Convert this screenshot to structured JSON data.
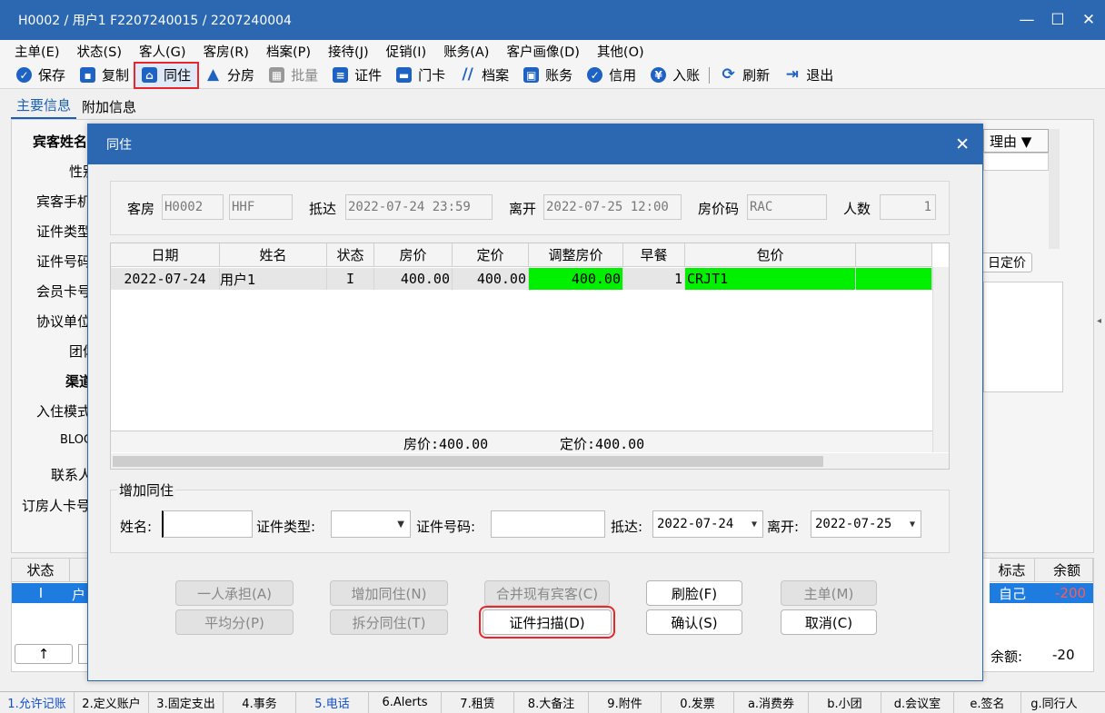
{
  "window": {
    "title": "H0002 / 用户1 F2207240015 / 2207240004",
    "min": "—",
    "max": "☐",
    "close": "✕"
  },
  "menu": [
    "主单(E)",
    "状态(S)",
    "客人(G)",
    "客房(R)",
    "档案(P)",
    "接待(J)",
    "促销(I)",
    "账务(A)",
    "客户画像(D)",
    "其他(O)"
  ],
  "toolbar": {
    "save": "保存",
    "copy": "复制",
    "share": "同住",
    "assign": "分房",
    "batch": "批量",
    "id": "证件",
    "card": "门卡",
    "profile": "档案",
    "account": "账务",
    "credit": "信用",
    "post": "入账",
    "refresh": "刷新",
    "exit": "退出"
  },
  "tabs": {
    "main": "主要信息",
    "extra": "附加信息"
  },
  "bg_labels": [
    "宾客姓名",
    "性别",
    "宾客手机",
    "证件类型",
    "证件号码",
    "会员卡号",
    "协议单位",
    "团体",
    "渠道",
    "入住模式",
    "BLOCK",
    "联系人",
    "订房人卡号"
  ],
  "bg_right": {
    "reason": "理由 ▼",
    "fixed_price_btn": "日定价",
    "arrow": "◂"
  },
  "bottom_grid": {
    "headers": {
      "status": "状态",
      "flag": "标志",
      "balance": "余额"
    },
    "row": {
      "status": "I",
      "name": "用户1",
      "flag": "自己",
      "balance": "-200"
    },
    "up": "↑",
    "balance_label": "余额:",
    "balance_value": "-20"
  },
  "dialog": {
    "title": "同住",
    "close": "✕",
    "room_label": "客房",
    "room_no": "H0002",
    "room_type": "HHF",
    "arrive_label": "抵达",
    "arrive": "2022-07-24 23:59",
    "depart_label": "离开",
    "depart": "2022-07-25 12:00",
    "rate_code_label": "房价码",
    "rate_code": "RAC",
    "pax_label": "人数",
    "pax": "1",
    "grid": {
      "headers": [
        "日期",
        "姓名",
        "状态",
        "房价",
        "定价",
        "调整房价",
        "早餐",
        "包价"
      ],
      "row": {
        "date": "2022-07-24",
        "name": "用户1",
        "status": "I",
        "rate": "400.00",
        "fixed": "400.00",
        "adjusted": "400.00",
        "breakfast": "1",
        "package": "CRJT1"
      },
      "footer_rate": "房价:400.00",
      "footer_fixed": "定价:400.00"
    },
    "add": {
      "legend": "增加同住",
      "name_label": "姓名:",
      "name_value": "",
      "id_type_label": "证件类型:",
      "id_type_value": "",
      "id_no_label": "证件号码:",
      "id_no_value": "",
      "arrive_label": "抵达:",
      "arrive": "2022-07-24",
      "depart_label": "离开:",
      "depart": "2022-07-25"
    },
    "buttons": {
      "one_pays": "一人承担(A)",
      "add_share": "增加同住(N)",
      "merge": "合并现有宾客(C)",
      "face": "刷脸(F)",
      "main": "主单(M)",
      "split_even": "平均分(P)",
      "split_share": "拆分同住(T)",
      "scan": "证件扫描(D)",
      "confirm": "确认(S)",
      "cancel": "取消(C)"
    }
  },
  "statusbar": [
    "1.允许记账",
    "2.定义账户",
    "3.固定支出",
    "4.事务",
    "5.电话",
    "6.Alerts",
    "7.租赁",
    "8.大备注",
    "9.附件",
    "0.发票",
    "a.消费券",
    "b.小团",
    "d.会议室",
    "e.签名",
    "g.同行人"
  ],
  "colors": {
    "title_blue": "#2b68b1",
    "highlight_red": "#e8262b",
    "cell_green": "#00f000",
    "select_blue": "#1e7be0"
  }
}
